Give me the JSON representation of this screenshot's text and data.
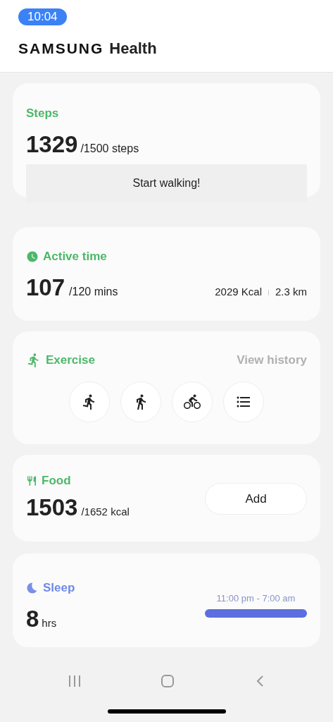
{
  "status_bar": {
    "time": "10:04"
  },
  "header": {
    "brand": "SAMSUNG",
    "product": "Health"
  },
  "steps": {
    "title": "Steps",
    "value": "1329",
    "goal": "/1500 steps",
    "button": "Start walking!"
  },
  "active_time": {
    "title": "Active time",
    "value": "107",
    "goal": "/120 mins",
    "calories": "2029 Kcal",
    "distance": "2.3 km"
  },
  "exercise": {
    "title": "Exercise",
    "link": "View history"
  },
  "food": {
    "title": "Food",
    "value": "1503",
    "goal": "/1652 kcal",
    "button": "Add"
  },
  "sleep": {
    "title": "Sleep",
    "value": "8",
    "unit": "hrs",
    "range": "11:00 pm - 7:00 am"
  }
}
